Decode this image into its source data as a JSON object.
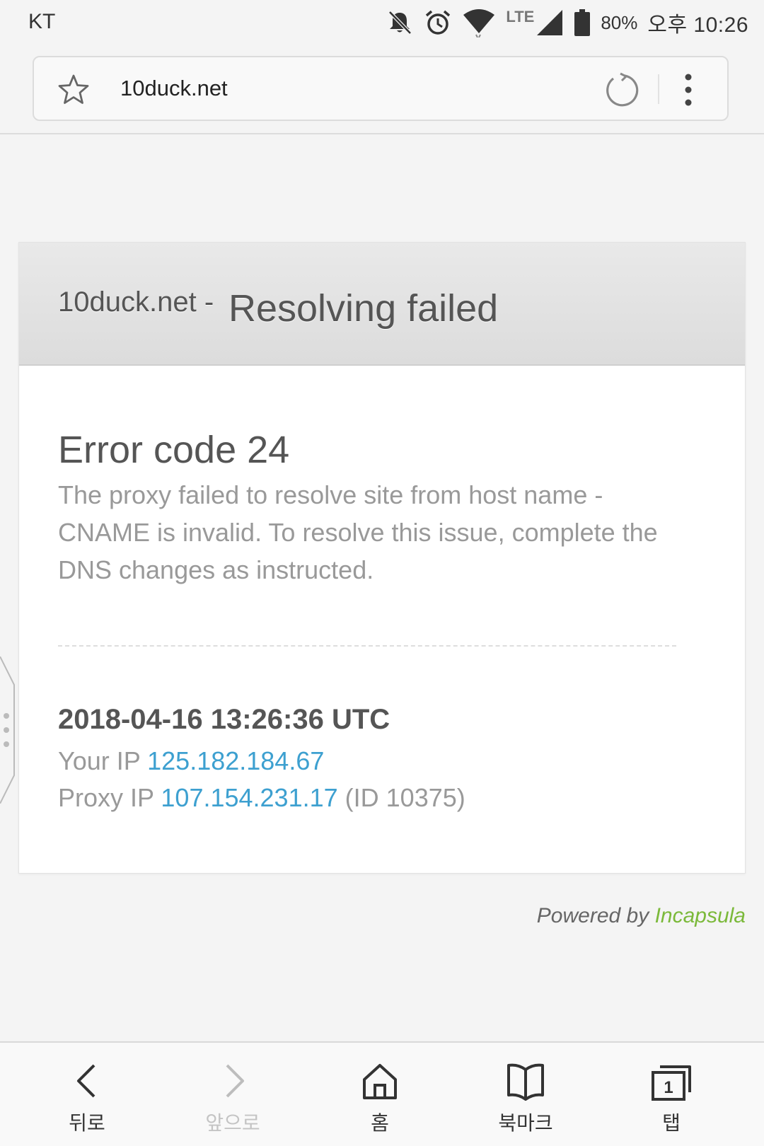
{
  "status_bar": {
    "carrier": "KT",
    "network": "LTE",
    "battery": "80%",
    "time": "오후 10:26",
    "icons": [
      "bell-muted-icon",
      "alarm-icon",
      "wifi-icon",
      "signal-icon",
      "battery-icon"
    ]
  },
  "browser": {
    "url": "10duck.net",
    "icons": [
      "star-icon",
      "reload-icon",
      "more-vert-icon"
    ]
  },
  "error_page": {
    "site": "10duck.net -",
    "title": "Resolving failed",
    "error_code": "Error code 24",
    "description": "The proxy failed to resolve site from host name - CNAME is invalid. To resolve this issue, complete the DNS changes as instructed.",
    "timestamp": "2018-04-16 13:26:36 UTC",
    "your_ip_label": "Your IP",
    "your_ip": "125.182.184.67",
    "proxy_ip_label": "Proxy IP",
    "proxy_ip": "107.154.231.17",
    "proxy_id": "(ID 10375)",
    "powered_by_prefix": "Powered by",
    "powered_by_brand": "Incapsula",
    "link_color": "#3da0d0",
    "brand_color": "#7bb93a"
  },
  "bottom_nav": {
    "back": "뒤로",
    "forward": "앞으로",
    "home": "홈",
    "bookmarks": "북마크",
    "tabs": "탭",
    "tab_count": "1"
  }
}
